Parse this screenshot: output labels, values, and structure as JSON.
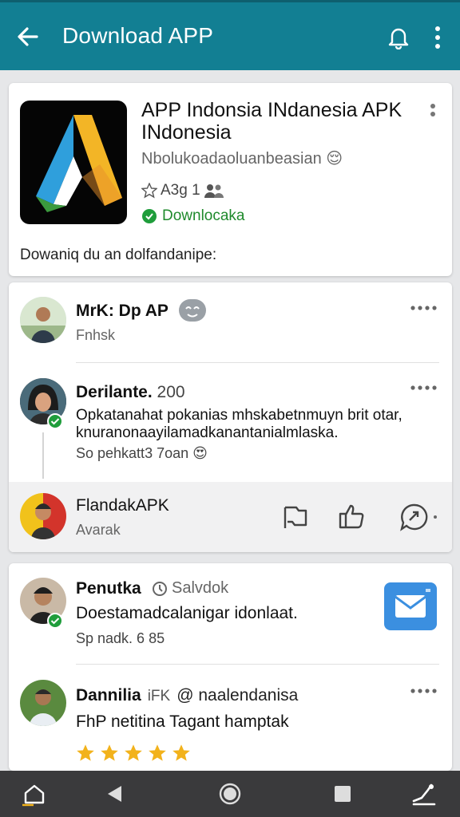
{
  "appbar": {
    "title": "Download APP",
    "back_icon": "back-arrow-icon",
    "bell_icon": "bell-icon",
    "more_icon": "more-vert-icon",
    "color": "#127f93"
  },
  "app_card": {
    "title": "APP Indonsia INdanesia APK INdonesia",
    "subtitle": "Nbolukoadaoluanbeasian 😌",
    "rating": "A3g 1",
    "download_label": "Downlocaka",
    "description": "Dowaniq du an dolfandanipe:"
  },
  "posts": [
    {
      "name": "MrK: Dp AP",
      "sub": "Fnhsk"
    },
    {
      "name": "Derilante.",
      "count": "200",
      "body": "Opkatanahat pokanias mhskabetnmuyn brit otar, knuranonaayilamadkanantanialmlaska.",
      "meta": "So pehkatt3 7oan 😍"
    },
    {
      "name": "FlandakAPK",
      "sub": "Avarak"
    }
  ],
  "posts2": [
    {
      "name": "Penutka",
      "tag": "Salvdok",
      "body": "Doestamadcalanigar idonlaat.",
      "meta": "Sp nadk. 6 85"
    },
    {
      "name": "Dannilia",
      "handle_prefix": "iFK",
      "handle": "@ naalendanisa",
      "body": "FhP netitina Tagant hamptak",
      "stars": 5
    }
  ],
  "colors": {
    "accent_green": "#1f8a2c",
    "star": "#f2b21b",
    "mail_blue": "#3b8fe0",
    "navbar": "#3a3a3c"
  }
}
